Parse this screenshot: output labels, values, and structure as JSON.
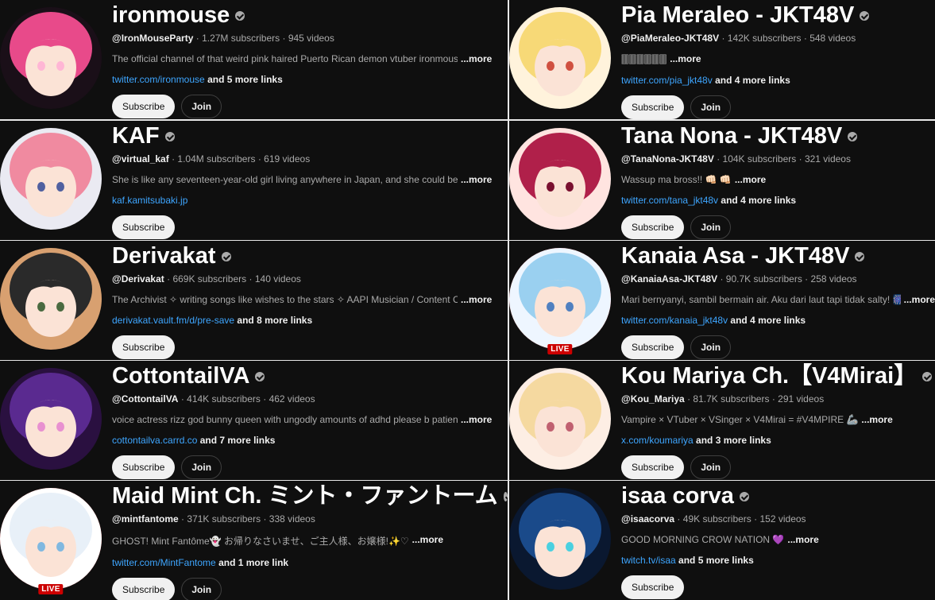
{
  "channels": [
    {
      "name": "ironmouse",
      "handle": "@IronMouseParty",
      "subs": "1.27M subscribers",
      "videos": "945 videos",
      "desc": "The official channel of that weird pink haired Puerto Rican demon vtuber ironmouse",
      "more": "...more",
      "link": "twitter.com/ironmouse",
      "links_more": "and 5 more links",
      "subscribe": "Subscribe",
      "join": "Join",
      "colors": [
        "#e84a8a",
        "#1a0f18",
        "#ffb6d5"
      ]
    },
    {
      "name": "Pia Meraleo - JKT48V",
      "handle": "@PiaMeraleo-JKT48V",
      "subs": "142K subscribers",
      "videos": "548 videos",
      "desc": "🀫🀫🀫🀫🀫🀫",
      "more": "...more",
      "link": "twitter.com/pia_jkt48v",
      "links_more": "and 4 more links",
      "subscribe": "Subscribe",
      "join": "Join",
      "colors": [
        "#f7d977",
        "#fff3dc",
        "#d05040"
      ]
    },
    {
      "name": "KAF",
      "handle": "@virtual_kaf",
      "subs": "1.04M subscribers",
      "videos": "619 videos",
      "desc": "She is like any seventeen-year-old girl living anywhere in Japan, and she could be anywhere",
      "more": "...more",
      "link": "kaf.kamitsubaki.jp",
      "links_more": "",
      "subscribe": "Subscribe",
      "join": "",
      "colors": [
        "#f08aa0",
        "#eaeaf2",
        "#5060a0"
      ]
    },
    {
      "name": "Tana Nona - JKT48V",
      "handle": "@TanaNona-JKT48V",
      "subs": "104K subscribers",
      "videos": "321 videos",
      "desc": "Wassup ma bross!! 👊🏻 👊🏻",
      "more": "...more",
      "link": "twitter.com/tana_jkt48v",
      "links_more": "and 4 more links",
      "subscribe": "Subscribe",
      "join": "Join",
      "colors": [
        "#b0204a",
        "#ffe4e0",
        "#7a1030"
      ]
    },
    {
      "name": "Derivakat",
      "handle": "@Derivakat",
      "subs": "669K subscribers",
      "videos": "140 videos",
      "desc": "The Archivist ✧ writing songs like wishes to the stars ✧ AAPI Musician / Content Creator",
      "more": "...more",
      "link": "derivakat.vault.fm/d/pre-save",
      "links_more": "and 8 more links",
      "subscribe": "Subscribe",
      "join": "",
      "colors": [
        "#2a2a2a",
        "#d8a070",
        "#4a6a40"
      ]
    },
    {
      "name": "Kanaia Asa - JKT48V",
      "handle": "@KanaiaAsa-JKT48V",
      "subs": "90.7K subscribers",
      "videos": "258 videos",
      "desc": "Mari bernyanyi, sambil bermain air. Aku dari laut tapi tidak salty! 🎆 🐟",
      "more": "...more",
      "link": "twitter.com/kanaia_jkt48v",
      "links_more": "and 4 more links",
      "subscribe": "Subscribe",
      "join": "Join",
      "colors": [
        "#9ad0f0",
        "#eef6ff",
        "#5080c0"
      ],
      "live": "LIVE"
    },
    {
      "name": "CottontailVA",
      "handle": "@CottontailVA",
      "subs": "414K subscribers",
      "videos": "462 videos",
      "desc": "voice actress rizz god bunny queen with ungodly amounts of adhd please b patient.",
      "more": "...more",
      "link": "cottontailva.carrd.co",
      "links_more": "and 7 more links",
      "subscribe": "Subscribe",
      "join": "Join",
      "colors": [
        "#5a2a90",
        "#2a1040",
        "#e890d0"
      ]
    },
    {
      "name": "Kou Mariya Ch.【V4Mirai】",
      "handle": "@Kou_Mariya",
      "subs": "81.7K subscribers",
      "videos": "291 videos",
      "desc": "Vampire × VTuber × VSinger × V4Mirai = #V4MPIRE 🦾",
      "more": "...more",
      "link": "x.com/koumariya",
      "links_more": "and 3 more links",
      "subscribe": "Subscribe",
      "join": "Join",
      "colors": [
        "#f5d9a0",
        "#fdeee4",
        "#c06070"
      ]
    },
    {
      "name": "Maid Mint Ch. ミント・ファントーム",
      "handle": "@mintfantome",
      "subs": "371K subscribers",
      "videos": "338 videos",
      "desc": "GHOST! Mint Fantôme👻 お帰りなさいませ、ご主人様、お嬢様!✨♡",
      "more": "...more",
      "link": "twitter.com/MintFantome",
      "links_more": "and 1 more link",
      "subscribe": "Subscribe",
      "join": "Join",
      "colors": [
        "#e8f0f8",
        "#ffffff",
        "#80b8e0"
      ],
      "live": "LIVE"
    },
    {
      "name": "isaa corva",
      "handle": "@isaacorva",
      "subs": "49K subscribers",
      "videos": "152 videos",
      "desc": "GOOD MORNING CROW NATION 💜",
      "more": "...more",
      "link": "twitch.tv/isaa",
      "links_more": "and 5 more links",
      "subscribe": "Subscribe",
      "join": "",
      "colors": [
        "#1a4a8a",
        "#0a1830",
        "#4ad0e0"
      ]
    }
  ]
}
